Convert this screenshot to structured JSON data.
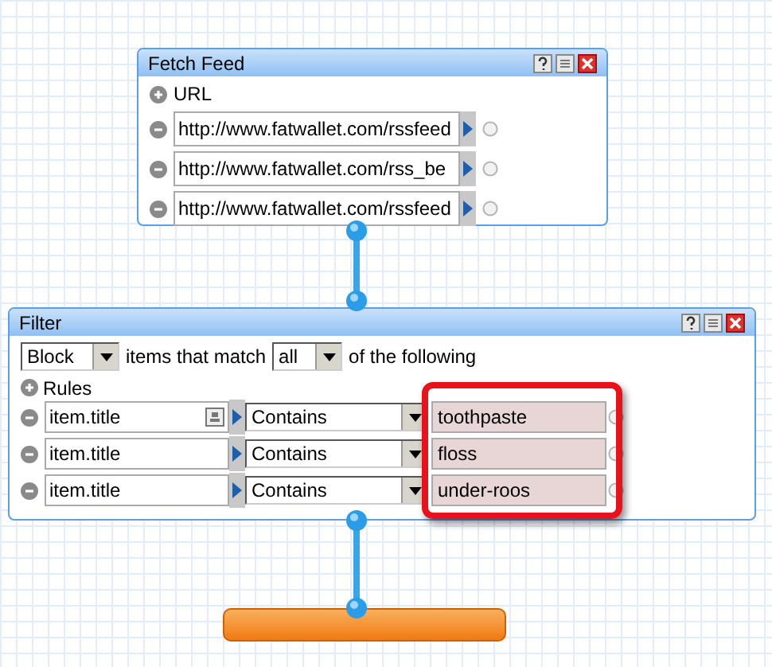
{
  "modules": [
    {
      "kind": "fetch",
      "title": "Fetch Feed",
      "add_label": "URL",
      "urls": [
        "http://www.fatwallet.com/rssfeed",
        "http://www.fatwallet.com/rss_be",
        "http://www.fatwallet.com/rssfeed"
      ]
    },
    {
      "kind": "filter",
      "title": "Filter",
      "action": "Block",
      "text_before": "items that match",
      "match": "all",
      "text_after": "of the following",
      "add_label": "Rules",
      "values_highlighted": true,
      "rules": [
        {
          "field": "item.title",
          "field_icon": true,
          "operator": "Contains",
          "value": "toothpaste"
        },
        {
          "field": "item.title",
          "field_icon": false,
          "operator": "Contains",
          "value": "floss"
        },
        {
          "field": "item.title",
          "field_icon": false,
          "operator": "Contains",
          "value": "under-roos"
        }
      ]
    },
    {
      "kind": "output"
    }
  ]
}
